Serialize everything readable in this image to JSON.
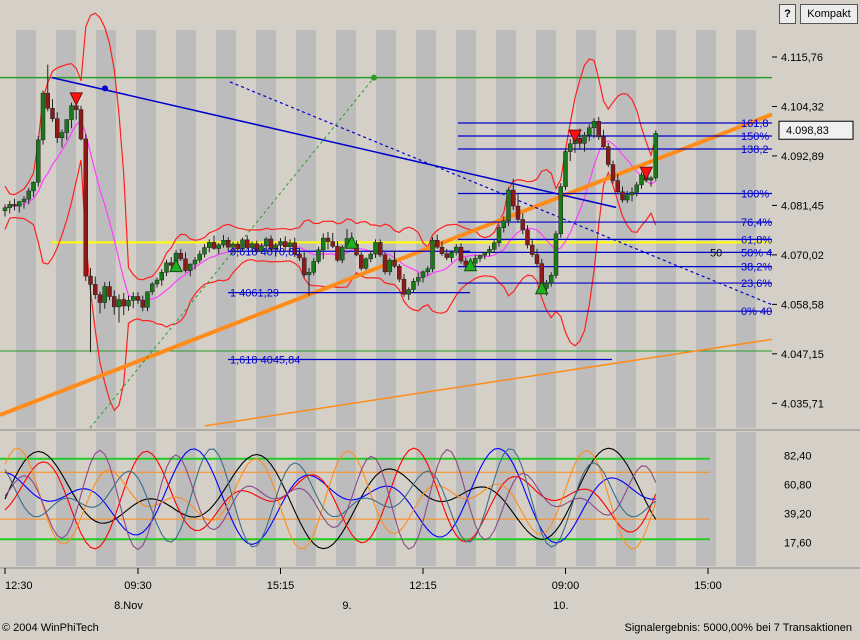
{
  "toolbar": {
    "help_label": "?",
    "compact_label": "Kompakt"
  },
  "footer": {
    "copyright": "© 2004 WinPhiTech",
    "signal_text": "Signalergebnis: 5000,00% bei 7 Transaktionen"
  },
  "colors": {
    "background": "#d4d0c8",
    "stripe": "#bcbcbc",
    "candle_up": "#1a7a1a",
    "candle_down": "#8b1a1a",
    "bollinger": "#ff2020",
    "moving_average": "#ff40ff",
    "trendline": "#ff8c1a",
    "channel": "#0000cc",
    "level_green": "#2a9a2a",
    "level_yellow": "#ffff00"
  },
  "chart_data": [
    {
      "type": "candlestick",
      "ylim": [
        4030,
        4122
      ],
      "y_ticks": [
        "4.115,76",
        "4.104,32",
        "4.092,89",
        "4.081,45",
        "4.070,02",
        "4.058,58",
        "4.047,15",
        "4.035,71"
      ],
      "y_tick_values": [
        4115.76,
        4104.32,
        4092.89,
        4081.45,
        4070.02,
        4058.58,
        4047.15,
        4035.71
      ],
      "x_ticks": [
        "12:30",
        "09:30",
        "15:15",
        "12:15",
        "09:00",
        "15:00"
      ],
      "x_tick_index": [
        0,
        28,
        58,
        88,
        118,
        148
      ],
      "date_labels": [
        {
          "text": "8.Nov",
          "index": 26
        },
        {
          "text": "9.",
          "index": 72
        },
        {
          "text": "10.",
          "index": 117
        }
      ],
      "last_price_label": "4.098,83",
      "last_price": 4098.83,
      "candles": [
        [
          4080.2,
          4081.7,
          4078.9,
          4080.9
        ],
        [
          4080.9,
          4082.5,
          4079.6,
          4081.7
        ],
        [
          4081.7,
          4083.0,
          4080.3,
          4081.3
        ],
        [
          4081.3,
          4082.5,
          4079.8,
          4082.3
        ],
        [
          4082.3,
          4083.6,
          4080.7,
          4082.9
        ],
        [
          4082.9,
          4085.5,
          4081.7,
          4084.8
        ],
        [
          4084.8,
          4087.0,
          4083.4,
          4086.8
        ],
        [
          4086.8,
          4097.5,
          4085.8,
          4096.6
        ],
        [
          4096.6,
          4108.0,
          4095.5,
          4107.4
        ],
        [
          4107.4,
          4114.0,
          4103.2,
          4103.9
        ],
        [
          4103.9,
          4106.0,
          4100.8,
          4101.5
        ],
        [
          4101.5,
          4103.0,
          4095.9,
          4097.1
        ],
        [
          4097.1,
          4099.0,
          4094.8,
          4098.3
        ],
        [
          4098.3,
          4101.4,
          4096.6,
          4101.3
        ],
        [
          4101.3,
          4105.2,
          4099.3,
          4104.5
        ],
        [
          4104.5,
          4107.0,
          4101.3,
          4103.6
        ],
        [
          4103.6,
          4104.5,
          4096.5,
          4096.8
        ],
        [
          4096.8,
          4098.0,
          4064.0,
          4065.1
        ],
        [
          4065.1,
          4067.0,
          4047.5,
          4063.2
        ],
        [
          4063.2,
          4065.0,
          4059.8,
          4060.8
        ],
        [
          4060.8,
          4061.5,
          4056.5,
          4059.0
        ],
        [
          4059.0,
          4063.7,
          4057.6,
          4062.7
        ],
        [
          4062.7,
          4063.9,
          4059.5,
          4060.4
        ],
        [
          4060.4,
          4061.8,
          4056.2,
          4058.0
        ],
        [
          4058.0,
          4060.9,
          4054.4,
          4059.7
        ],
        [
          4059.7,
          4061.2,
          4056.1,
          4058.2
        ],
        [
          4058.2,
          4060.5,
          4057.1,
          4059.5
        ],
        [
          4059.5,
          4061.4,
          4057.7,
          4060.4
        ],
        [
          4060.4,
          4061.4,
          4058.7,
          4059.5
        ],
        [
          4059.5,
          4060.6,
          4057.0,
          4057.9
        ],
        [
          4057.9,
          4061.5,
          4057.0,
          4061.5
        ],
        [
          4061.5,
          4063.7,
          4060.8,
          4063.3
        ],
        [
          4063.3,
          4064.8,
          4062.5,
          4064.2
        ],
        [
          4064.2,
          4066.7,
          4062.9,
          4066.0
        ],
        [
          4066.0,
          4068.9,
          4065.1,
          4068.2
        ],
        [
          4068.2,
          4069.5,
          4066.4,
          4067.6
        ],
        [
          4067.6,
          4071.1,
          4066.6,
          4070.4
        ],
        [
          4070.4,
          4071.4,
          4068.6,
          4069.1
        ],
        [
          4069.1,
          4070.6,
          4065.9,
          4066.4
        ],
        [
          4066.4,
          4068.0,
          4065.1,
          4067.9
        ],
        [
          4067.9,
          4069.5,
          4066.6,
          4068.8
        ],
        [
          4068.8,
          4071.0,
          4068.1,
          4070.2
        ],
        [
          4070.2,
          4072.5,
          4069.4,
          4071.7
        ],
        [
          4071.7,
          4073.6,
          4070.6,
          4072.9
        ],
        [
          4072.9,
          4074.5,
          4071.2,
          4071.5
        ],
        [
          4071.5,
          4072.8,
          4070.2,
          4072.3
        ],
        [
          4072.3,
          4074.6,
          4071.7,
          4073.4
        ],
        [
          4073.4,
          4074.1,
          4071.0,
          4071.8
        ],
        [
          4071.8,
          4073.0,
          4070.3,
          4072.5
        ],
        [
          4072.5,
          4073.1,
          4070.5,
          4071.4
        ],
        [
          4071.4,
          4074.0,
          4070.8,
          4073.5
        ],
        [
          4073.5,
          4074.5,
          4071.5,
          4071.7
        ],
        [
          4071.7,
          4073.1,
          4070.9,
          4072.6
        ],
        [
          4072.6,
          4073.3,
          4070.4,
          4070.9
        ],
        [
          4070.9,
          4072.7,
          4070.4,
          4072.1
        ],
        [
          4072.1,
          4074.1,
          4070.9,
          4073.7
        ],
        [
          4073.7,
          4074.5,
          4070.8,
          4071.3
        ],
        [
          4071.3,
          4072.8,
          4069.6,
          4072.3
        ],
        [
          4072.3,
          4073.9,
          4071.0,
          4073.1
        ],
        [
          4073.1,
          4074.3,
          4071.1,
          4071.9
        ],
        [
          4071.9,
          4073.6,
          4070.9,
          4072.8
        ],
        [
          4072.8,
          4074.0,
          4069.5,
          4070.2
        ],
        [
          4070.2,
          4071.5,
          4068.6,
          4069.3
        ],
        [
          4069.3,
          4070.6,
          4064.8,
          4065.4
        ],
        [
          4065.4,
          4067.0,
          4060.6,
          4066.0
        ],
        [
          4066.0,
          4069.3,
          4065.3,
          4068.5
        ],
        [
          4068.5,
          4071.9,
          4068.0,
          4071.2
        ],
        [
          4071.2,
          4075.0,
          4069.0,
          4073.9
        ],
        [
          4073.9,
          4075.3,
          4071.3,
          4073.1
        ],
        [
          4073.1,
          4075.1,
          4071.6,
          4072.0
        ],
        [
          4072.0,
          4073.2,
          4068.4,
          4068.8
        ],
        [
          4068.8,
          4072.3,
          4068.1,
          4071.8
        ],
        [
          4071.8,
          4076.0,
          4071.4,
          4073.8
        ],
        [
          4073.8,
          4075.2,
          4072.0,
          4072.5
        ],
        [
          4072.5,
          4073.4,
          4069.7,
          4070.0
        ],
        [
          4070.0,
          4070.6,
          4066.4,
          4066.9
        ],
        [
          4066.9,
          4069.5,
          4066.5,
          4069.1
        ],
        [
          4069.1,
          4071.0,
          4068.3,
          4070.2
        ],
        [
          4070.2,
          4073.6,
          4069.3,
          4072.9
        ],
        [
          4072.9,
          4073.6,
          4069.5,
          4070.0
        ],
        [
          4070.0,
          4070.6,
          4065.5,
          4066.1
        ],
        [
          4066.1,
          4069.3,
          4065.3,
          4068.8
        ],
        [
          4068.8,
          4070.9,
          4067.0,
          4067.4
        ],
        [
          4067.4,
          4067.9,
          4063.7,
          4064.4
        ],
        [
          4064.4,
          4065.6,
          4060.3,
          4060.9
        ],
        [
          4060.9,
          4062.5,
          4059.6,
          4062.0
        ],
        [
          4062.0,
          4064.6,
          4061.3,
          4063.9
        ],
        [
          4063.9,
          4065.9,
          4062.9,
          4064.8
        ],
        [
          4064.8,
          4066.4,
          4063.6,
          4066.1
        ],
        [
          4066.1,
          4067.4,
          4065.3,
          4066.8
        ],
        [
          4066.8,
          4074.1,
          4066.1,
          4073.4
        ],
        [
          4073.4,
          4074.7,
          4071.4,
          4071.8
        ],
        [
          4071.8,
          4073.1,
          4069.8,
          4070.3
        ],
        [
          4070.3,
          4071.4,
          4068.8,
          4069.4
        ],
        [
          4069.4,
          4071.1,
          4068.3,
          4070.6
        ],
        [
          4070.6,
          4072.5,
          4069.9,
          4071.8
        ],
        [
          4071.8,
          4072.7,
          4068.0,
          4068.6
        ],
        [
          4068.6,
          4069.4,
          4066.7,
          4067.6
        ],
        [
          4067.6,
          4068.8,
          4066.8,
          4068.1
        ],
        [
          4068.1,
          4070.0,
          4067.4,
          4069.2
        ],
        [
          4069.2,
          4070.1,
          4068.4,
          4069.9
        ],
        [
          4069.9,
          4070.7,
          4069.0,
          4070.5
        ],
        [
          4070.5,
          4072.1,
          4069.7,
          4071.3
        ],
        [
          4071.3,
          4073.4,
          4070.5,
          4072.8
        ],
        [
          4072.8,
          4077.0,
          4071.9,
          4076.3
        ],
        [
          4076.3,
          4078.9,
          4075.2,
          4077.9
        ],
        [
          4077.9,
          4085.6,
          4076.7,
          4085.0
        ],
        [
          4085.0,
          4087.6,
          4080.4,
          4081.3
        ],
        [
          4081.3,
          4084.1,
          4077.6,
          4078.2
        ],
        [
          4078.2,
          4079.6,
          4074.8,
          4075.8
        ],
        [
          4075.8,
          4076.9,
          4071.5,
          4072.3
        ],
        [
          4072.3,
          4073.4,
          4069.5,
          4070.1
        ],
        [
          4070.1,
          4071.4,
          4067.2,
          4068.0
        ],
        [
          4068.0,
          4069.1,
          4061.5,
          4062.3
        ],
        [
          4062.3,
          4064.2,
          4060.6,
          4063.5
        ],
        [
          4063.5,
          4066.0,
          4062.7,
          4065.3
        ],
        [
          4065.3,
          4075.6,
          4064.6,
          4074.9
        ],
        [
          4074.9,
          4086.6,
          4074.0,
          4085.8
        ],
        [
          4085.8,
          4094.6,
          4085.0,
          4093.9
        ],
        [
          4093.9,
          4096.8,
          4091.7,
          4095.7
        ],
        [
          4095.7,
          4098.4,
          4093.6,
          4097.0
        ],
        [
          4097.0,
          4099.2,
          4094.4,
          4095.8
        ],
        [
          4095.8,
          4098.4,
          4093.9,
          4097.7
        ],
        [
          4097.7,
          4100.2,
          4096.3,
          4099.4
        ],
        [
          4099.4,
          4101.6,
          4097.0,
          4100.9
        ],
        [
          4100.9,
          4101.9,
          4096.6,
          4097.3
        ],
        [
          4097.3,
          4098.9,
          4094.4,
          4095.0
        ],
        [
          4095.0,
          4095.9,
          4090.3,
          4090.9
        ],
        [
          4090.9,
          4091.8,
          4086.5,
          4087.2
        ],
        [
          4087.2,
          4088.7,
          4084.0,
          4084.6
        ],
        [
          4084.6,
          4085.8,
          4082.1,
          4082.7
        ],
        [
          4082.7,
          4084.8,
          4082.0,
          4083.9
        ],
        [
          4083.9,
          4085.6,
          4082.4,
          4084.5
        ],
        [
          4084.5,
          4086.9,
          4083.5,
          4086.2
        ],
        [
          4086.2,
          4089.1,
          4085.3,
          4088.5
        ],
        [
          4088.5,
          4089.8,
          4086.8,
          4087.3
        ],
        [
          4087.3,
          4088.3,
          4085.8,
          4087.8
        ],
        [
          4087.8,
          4098.8,
          4087.2,
          4098.1
        ]
      ],
      "fibonacci_labels": [
        {
          "text": "161,8",
          "value": 4100.5
        },
        {
          "text": "150%",
          "value": 4097.5
        },
        {
          "text": "138,2",
          "value": 4094.5
        },
        {
          "text": "100%",
          "value": 4084.2
        },
        {
          "text": "76,4%",
          "value": 4077.6
        },
        {
          "text": "61,8%",
          "value": 4073.6
        },
        {
          "text": "50% 4",
          "value": 4070.6
        },
        {
          "text": "38,2%",
          "value": 4067.3
        },
        {
          "text": "23,6%",
          "value": 4063.5
        },
        {
          "text": "0% 40",
          "value": 4057.0
        }
      ],
      "extension_labels": [
        {
          "text": "0,618  4070,85",
          "value": 4070.85
        },
        {
          "text": "1  4061,29",
          "value": 4061.29
        },
        {
          "text": "1,618  4045,84",
          "value": 4045.84
        }
      ],
      "side_label": {
        "text": "50",
        "value": 4070.6
      }
    },
    {
      "type": "line",
      "y_ticks": [
        "82,40",
        "60,80",
        "39,20",
        "17,60"
      ],
      "y_tick_values": [
        82.4,
        60.8,
        39.2,
        17.6
      ],
      "ylim": [
        0,
        100
      ],
      "reference_lines": [
        80,
        70,
        35,
        20
      ]
    }
  ]
}
